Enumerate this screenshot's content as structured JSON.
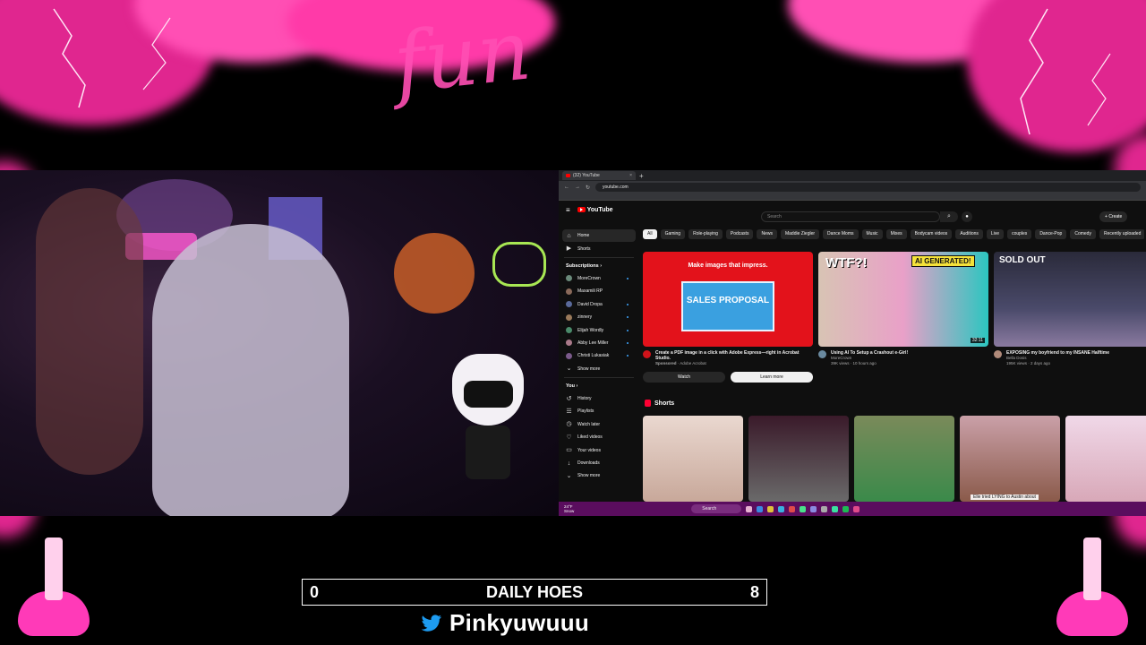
{
  "overlay": {
    "logo_text": "fun",
    "counter": {
      "left": "0",
      "label": "DAILY HOES",
      "right": "8"
    },
    "handle": "Pinkyuwuuu"
  },
  "browser": {
    "tab_title": "(32) YouTube",
    "url": "youtube.com"
  },
  "youtube": {
    "logo": "YouTube",
    "search_placeholder": "Search",
    "create_label": "Create",
    "sidebar": {
      "top": [
        {
          "label": "Home",
          "icon": "home-icon"
        },
        {
          "label": "Shorts",
          "icon": "shorts-icon"
        }
      ],
      "subscriptions_title": "Subscriptions",
      "subscriptions": [
        {
          "label": "MoreCrown"
        },
        {
          "label": "Maxamili RP"
        },
        {
          "label": "David Dropa"
        },
        {
          "label": "zinnery"
        },
        {
          "label": "Elijah Wordly"
        },
        {
          "label": "Abby Lee Miller"
        },
        {
          "label": "Christi Lukasiak"
        }
      ],
      "show_more_1": "Show more",
      "you_title": "You",
      "you_items": [
        {
          "label": "History",
          "icon": "history-icon"
        },
        {
          "label": "Playlists",
          "icon": "playlist-icon"
        },
        {
          "label": "Watch later",
          "icon": "clock-icon"
        },
        {
          "label": "Liked videos",
          "icon": "thumbs-up-icon"
        },
        {
          "label": "Your videos",
          "icon": "video-icon"
        },
        {
          "label": "Downloads",
          "icon": "download-icon"
        }
      ],
      "show_more_2": "Show more"
    },
    "chips": [
      "All",
      "Gaming",
      "Role-playing",
      "Podcasts",
      "News",
      "Maddie Ziegler",
      "Dance Moms",
      "Music",
      "Mixes",
      "Bodycam videos",
      "Auditions",
      "Live",
      "couples",
      "Dance-Pop",
      "Comedy",
      "Recently uploaded"
    ],
    "cards": [
      {
        "thumb_headline": "Make images that impress.",
        "thumb_doc": "SALES PROPOSAL",
        "title": "Create a PDF image in a click with Adobe Express—right in Acrobat Studio.",
        "sub1": "Sponsored",
        "sub2": "· Adobe Acrobat",
        "watch": "Watch",
        "learn_more": "Learn more"
      },
      {
        "thumb_left": "WTF?!",
        "thumb_right": "AI GENERATED!",
        "duration": "32:11",
        "title": "Using AI To Setup a Crashout e-Girl!",
        "channel": "MoreCrown",
        "stats": "39K views · 10 hours ago"
      },
      {
        "thumb_text": "SOLD OUT",
        "title": "EXPOSING my boyfriend to my INSANE Halftime",
        "channel": "Bella Dosis",
        "stats": "195K views · 2 days ago"
      }
    ],
    "shorts_title": "Shorts",
    "shorts_caption": "Elle tried LYING to Austin about"
  },
  "taskbar": {
    "weather_temp": "24°F",
    "weather_desc": "Snow",
    "search": "Search"
  },
  "colors": {
    "overlay_pink": "#ff2fa3",
    "youtube_red": "#ff0000",
    "taskbar": "#5a0d5e",
    "twitter_blue": "#1d9bf0"
  }
}
